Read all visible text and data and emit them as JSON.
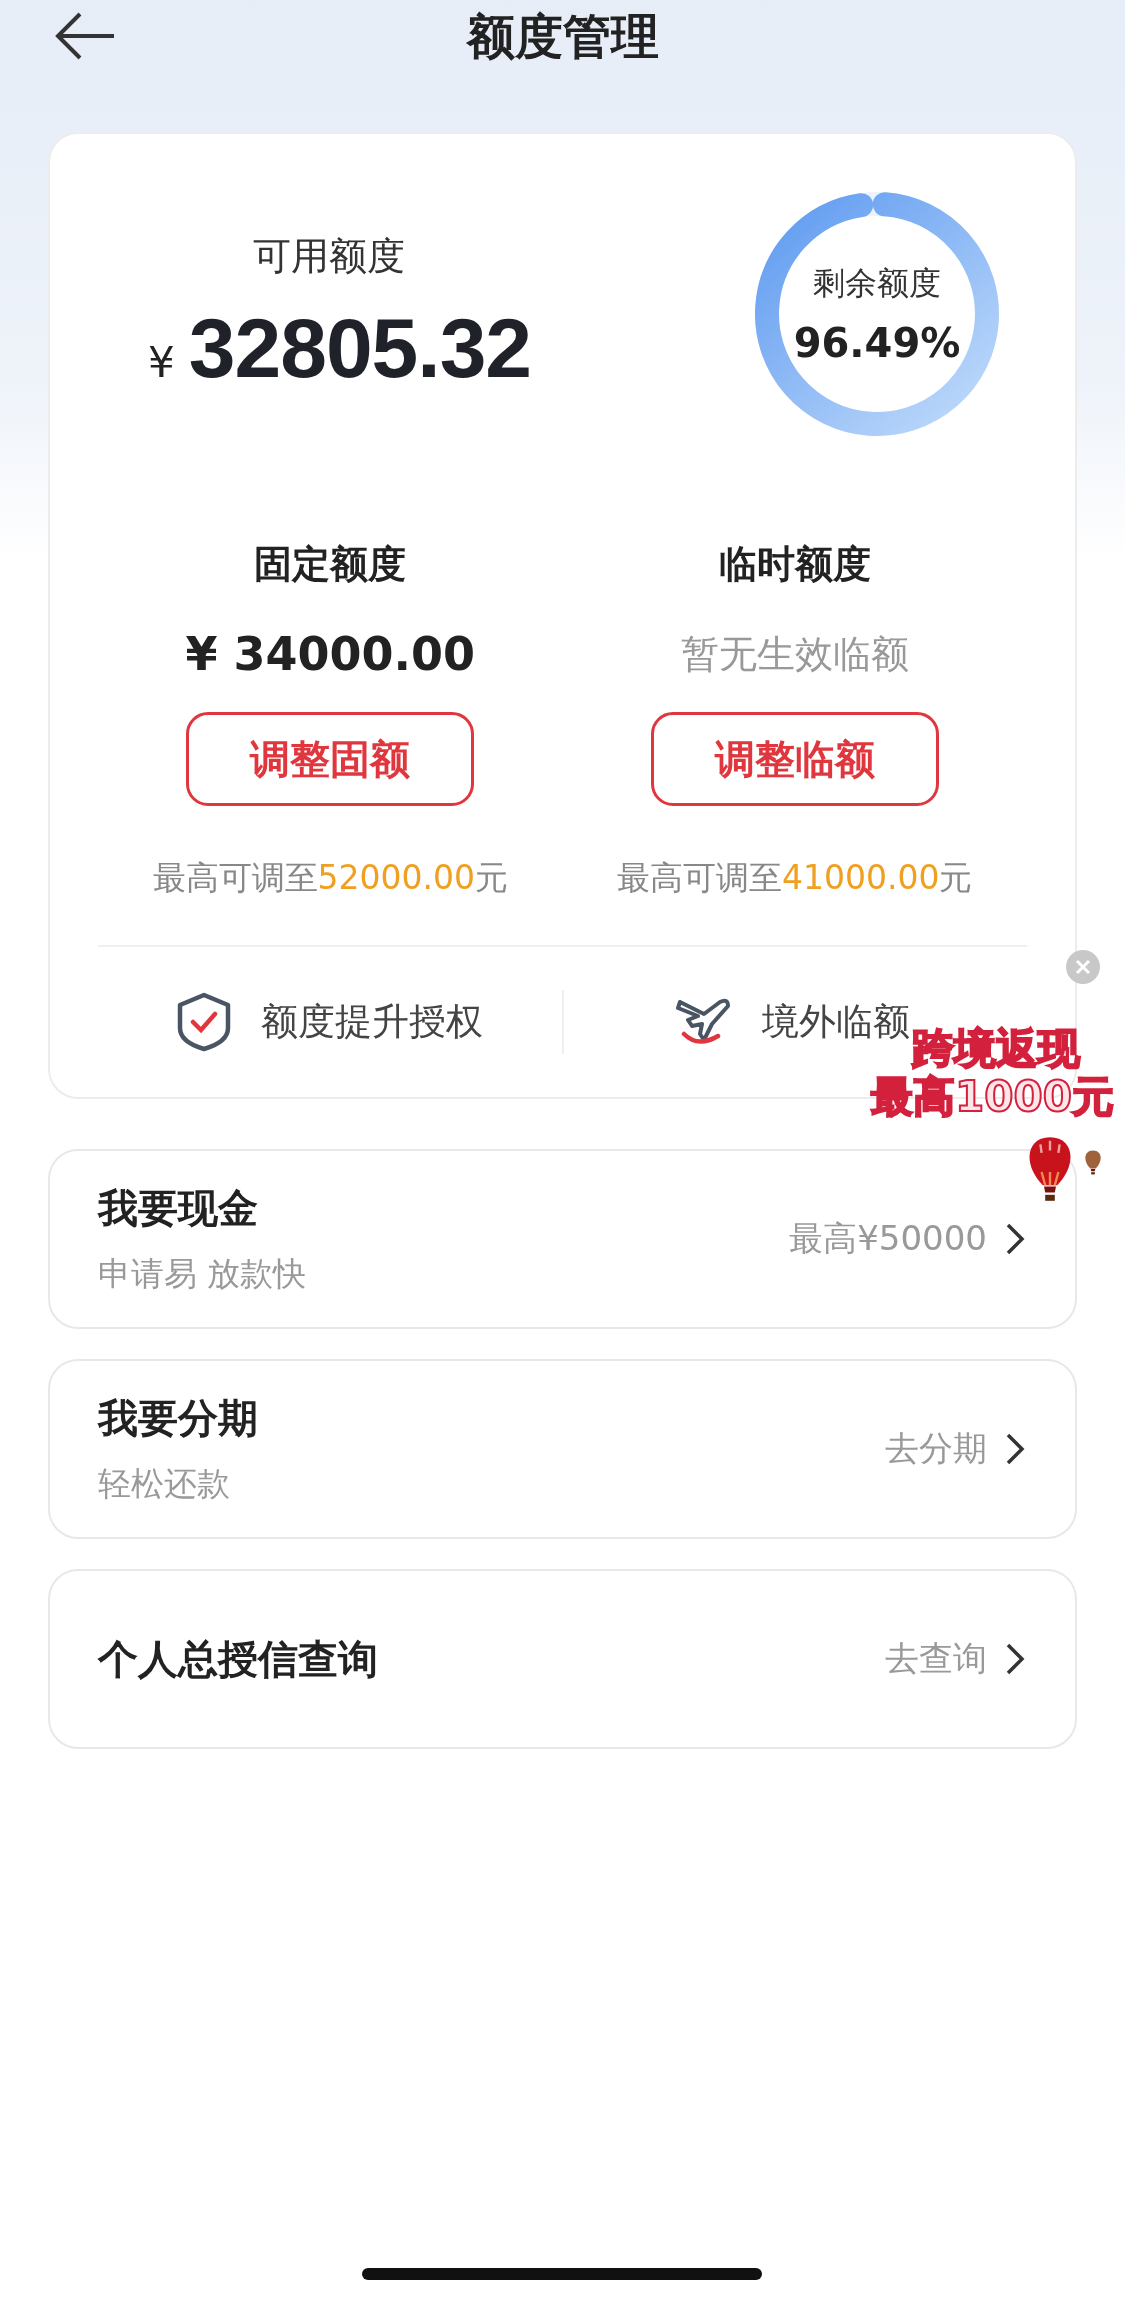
{
  "header": {
    "title": "额度管理"
  },
  "summary": {
    "label": "可用额度",
    "currency": "¥",
    "amount": "32805.32",
    "ring": {
      "label": "剩余额度",
      "reading": "96.49%",
      "level": 0.9649
    }
  },
  "quotas": [
    {
      "title": "固定额度",
      "kind": "amount",
      "value": "¥ 34000.00",
      "button": "调整固额",
      "limit_prefix": "最高可调至",
      "limit_value": "52000.00",
      "limit_suffix": "元"
    },
    {
      "title": "临时额度",
      "kind": "note",
      "value": "暂无生效临额",
      "button": "调整临额",
      "limit_prefix": "最高可调至",
      "limit_value": "41000.00",
      "limit_suffix": "元"
    }
  ],
  "quick_links": [
    {
      "label": "额度提升授权",
      "kind": "shield"
    },
    {
      "label": "境外临额",
      "kind": "plane"
    }
  ],
  "promo": {
    "lines": [
      "跨境返现",
      "最高1000元"
    ]
  },
  "entries": [
    {
      "title": "我要现金",
      "subtitle": "申请易 放款快",
      "action": "最高¥50000"
    },
    {
      "title": "我要分期",
      "subtitle": "轻松还款",
      "action": "去分期"
    },
    {
      "title": "个人总授信查询",
      "action": "去查询"
    }
  ]
}
